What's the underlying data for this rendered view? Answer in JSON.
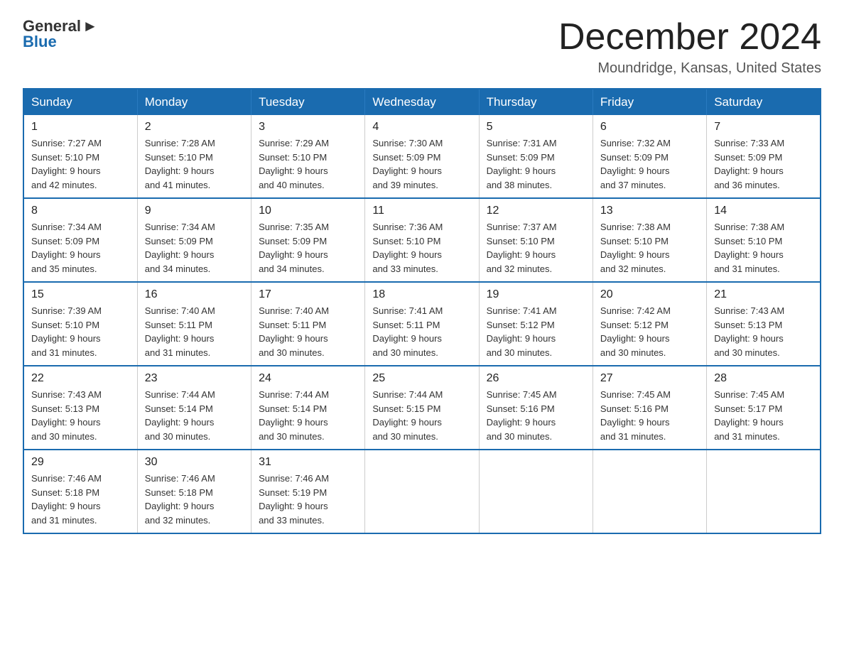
{
  "logo": {
    "general": "General",
    "blue": "Blue"
  },
  "title": "December 2024",
  "location": "Moundridge, Kansas, United States",
  "days_of_week": [
    "Sunday",
    "Monday",
    "Tuesday",
    "Wednesday",
    "Thursday",
    "Friday",
    "Saturday"
  ],
  "weeks": [
    [
      {
        "day": "1",
        "sunrise": "7:27 AM",
        "sunset": "5:10 PM",
        "daylight": "9 hours and 42 minutes."
      },
      {
        "day": "2",
        "sunrise": "7:28 AM",
        "sunset": "5:10 PM",
        "daylight": "9 hours and 41 minutes."
      },
      {
        "day": "3",
        "sunrise": "7:29 AM",
        "sunset": "5:10 PM",
        "daylight": "9 hours and 40 minutes."
      },
      {
        "day": "4",
        "sunrise": "7:30 AM",
        "sunset": "5:09 PM",
        "daylight": "9 hours and 39 minutes."
      },
      {
        "day": "5",
        "sunrise": "7:31 AM",
        "sunset": "5:09 PM",
        "daylight": "9 hours and 38 minutes."
      },
      {
        "day": "6",
        "sunrise": "7:32 AM",
        "sunset": "5:09 PM",
        "daylight": "9 hours and 37 minutes."
      },
      {
        "day": "7",
        "sunrise": "7:33 AM",
        "sunset": "5:09 PM",
        "daylight": "9 hours and 36 minutes."
      }
    ],
    [
      {
        "day": "8",
        "sunrise": "7:34 AM",
        "sunset": "5:09 PM",
        "daylight": "9 hours and 35 minutes."
      },
      {
        "day": "9",
        "sunrise": "7:34 AM",
        "sunset": "5:09 PM",
        "daylight": "9 hours and 34 minutes."
      },
      {
        "day": "10",
        "sunrise": "7:35 AM",
        "sunset": "5:09 PM",
        "daylight": "9 hours and 34 minutes."
      },
      {
        "day": "11",
        "sunrise": "7:36 AM",
        "sunset": "5:10 PM",
        "daylight": "9 hours and 33 minutes."
      },
      {
        "day": "12",
        "sunrise": "7:37 AM",
        "sunset": "5:10 PM",
        "daylight": "9 hours and 32 minutes."
      },
      {
        "day": "13",
        "sunrise": "7:38 AM",
        "sunset": "5:10 PM",
        "daylight": "9 hours and 32 minutes."
      },
      {
        "day": "14",
        "sunrise": "7:38 AM",
        "sunset": "5:10 PM",
        "daylight": "9 hours and 31 minutes."
      }
    ],
    [
      {
        "day": "15",
        "sunrise": "7:39 AM",
        "sunset": "5:10 PM",
        "daylight": "9 hours and 31 minutes."
      },
      {
        "day": "16",
        "sunrise": "7:40 AM",
        "sunset": "5:11 PM",
        "daylight": "9 hours and 31 minutes."
      },
      {
        "day": "17",
        "sunrise": "7:40 AM",
        "sunset": "5:11 PM",
        "daylight": "9 hours and 30 minutes."
      },
      {
        "day": "18",
        "sunrise": "7:41 AM",
        "sunset": "5:11 PM",
        "daylight": "9 hours and 30 minutes."
      },
      {
        "day": "19",
        "sunrise": "7:41 AM",
        "sunset": "5:12 PM",
        "daylight": "9 hours and 30 minutes."
      },
      {
        "day": "20",
        "sunrise": "7:42 AM",
        "sunset": "5:12 PM",
        "daylight": "9 hours and 30 minutes."
      },
      {
        "day": "21",
        "sunrise": "7:43 AM",
        "sunset": "5:13 PM",
        "daylight": "9 hours and 30 minutes."
      }
    ],
    [
      {
        "day": "22",
        "sunrise": "7:43 AM",
        "sunset": "5:13 PM",
        "daylight": "9 hours and 30 minutes."
      },
      {
        "day": "23",
        "sunrise": "7:44 AM",
        "sunset": "5:14 PM",
        "daylight": "9 hours and 30 minutes."
      },
      {
        "day": "24",
        "sunrise": "7:44 AM",
        "sunset": "5:14 PM",
        "daylight": "9 hours and 30 minutes."
      },
      {
        "day": "25",
        "sunrise": "7:44 AM",
        "sunset": "5:15 PM",
        "daylight": "9 hours and 30 minutes."
      },
      {
        "day": "26",
        "sunrise": "7:45 AM",
        "sunset": "5:16 PM",
        "daylight": "9 hours and 30 minutes."
      },
      {
        "day": "27",
        "sunrise": "7:45 AM",
        "sunset": "5:16 PM",
        "daylight": "9 hours and 31 minutes."
      },
      {
        "day": "28",
        "sunrise": "7:45 AM",
        "sunset": "5:17 PM",
        "daylight": "9 hours and 31 minutes."
      }
    ],
    [
      {
        "day": "29",
        "sunrise": "7:46 AM",
        "sunset": "5:18 PM",
        "daylight": "9 hours and 31 minutes."
      },
      {
        "day": "30",
        "sunrise": "7:46 AM",
        "sunset": "5:18 PM",
        "daylight": "9 hours and 32 minutes."
      },
      {
        "day": "31",
        "sunrise": "7:46 AM",
        "sunset": "5:19 PM",
        "daylight": "9 hours and 33 minutes."
      },
      null,
      null,
      null,
      null
    ]
  ],
  "labels": {
    "sunrise": "Sunrise:",
    "sunset": "Sunset:",
    "daylight": "Daylight:"
  }
}
